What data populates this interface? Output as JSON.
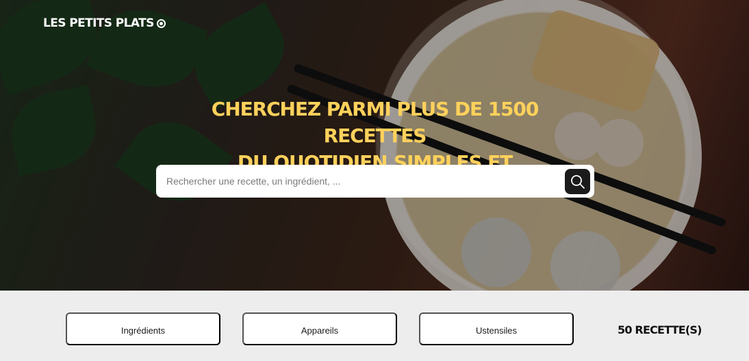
{
  "header": {
    "title": "LES PETITS PLATS",
    "logo_icon": "circle-dot-icon"
  },
  "hero": {
    "heading_line_1": "CHERCHEZ PARMI PLUS DE 1500 RECETTES",
    "heading_line_2": "DU QUOTIDIEN,SIMPLES ET DÉLICIEUSES"
  },
  "search": {
    "placeholder": "Rechercher une recette, un ingrédient, ...",
    "value": "",
    "button_icon": "search-icon"
  },
  "filters": {
    "ingredients": "Ingrédients",
    "appliances": "Appareils",
    "utensils": "Ustensiles"
  },
  "recipes": {
    "count_text": "50 RECETTE(S)"
  },
  "colors": {
    "accent": "#ffd15b",
    "dark": "#1b1b1b",
    "filter_background": "#ffffff",
    "page_background": "#ededed"
  }
}
